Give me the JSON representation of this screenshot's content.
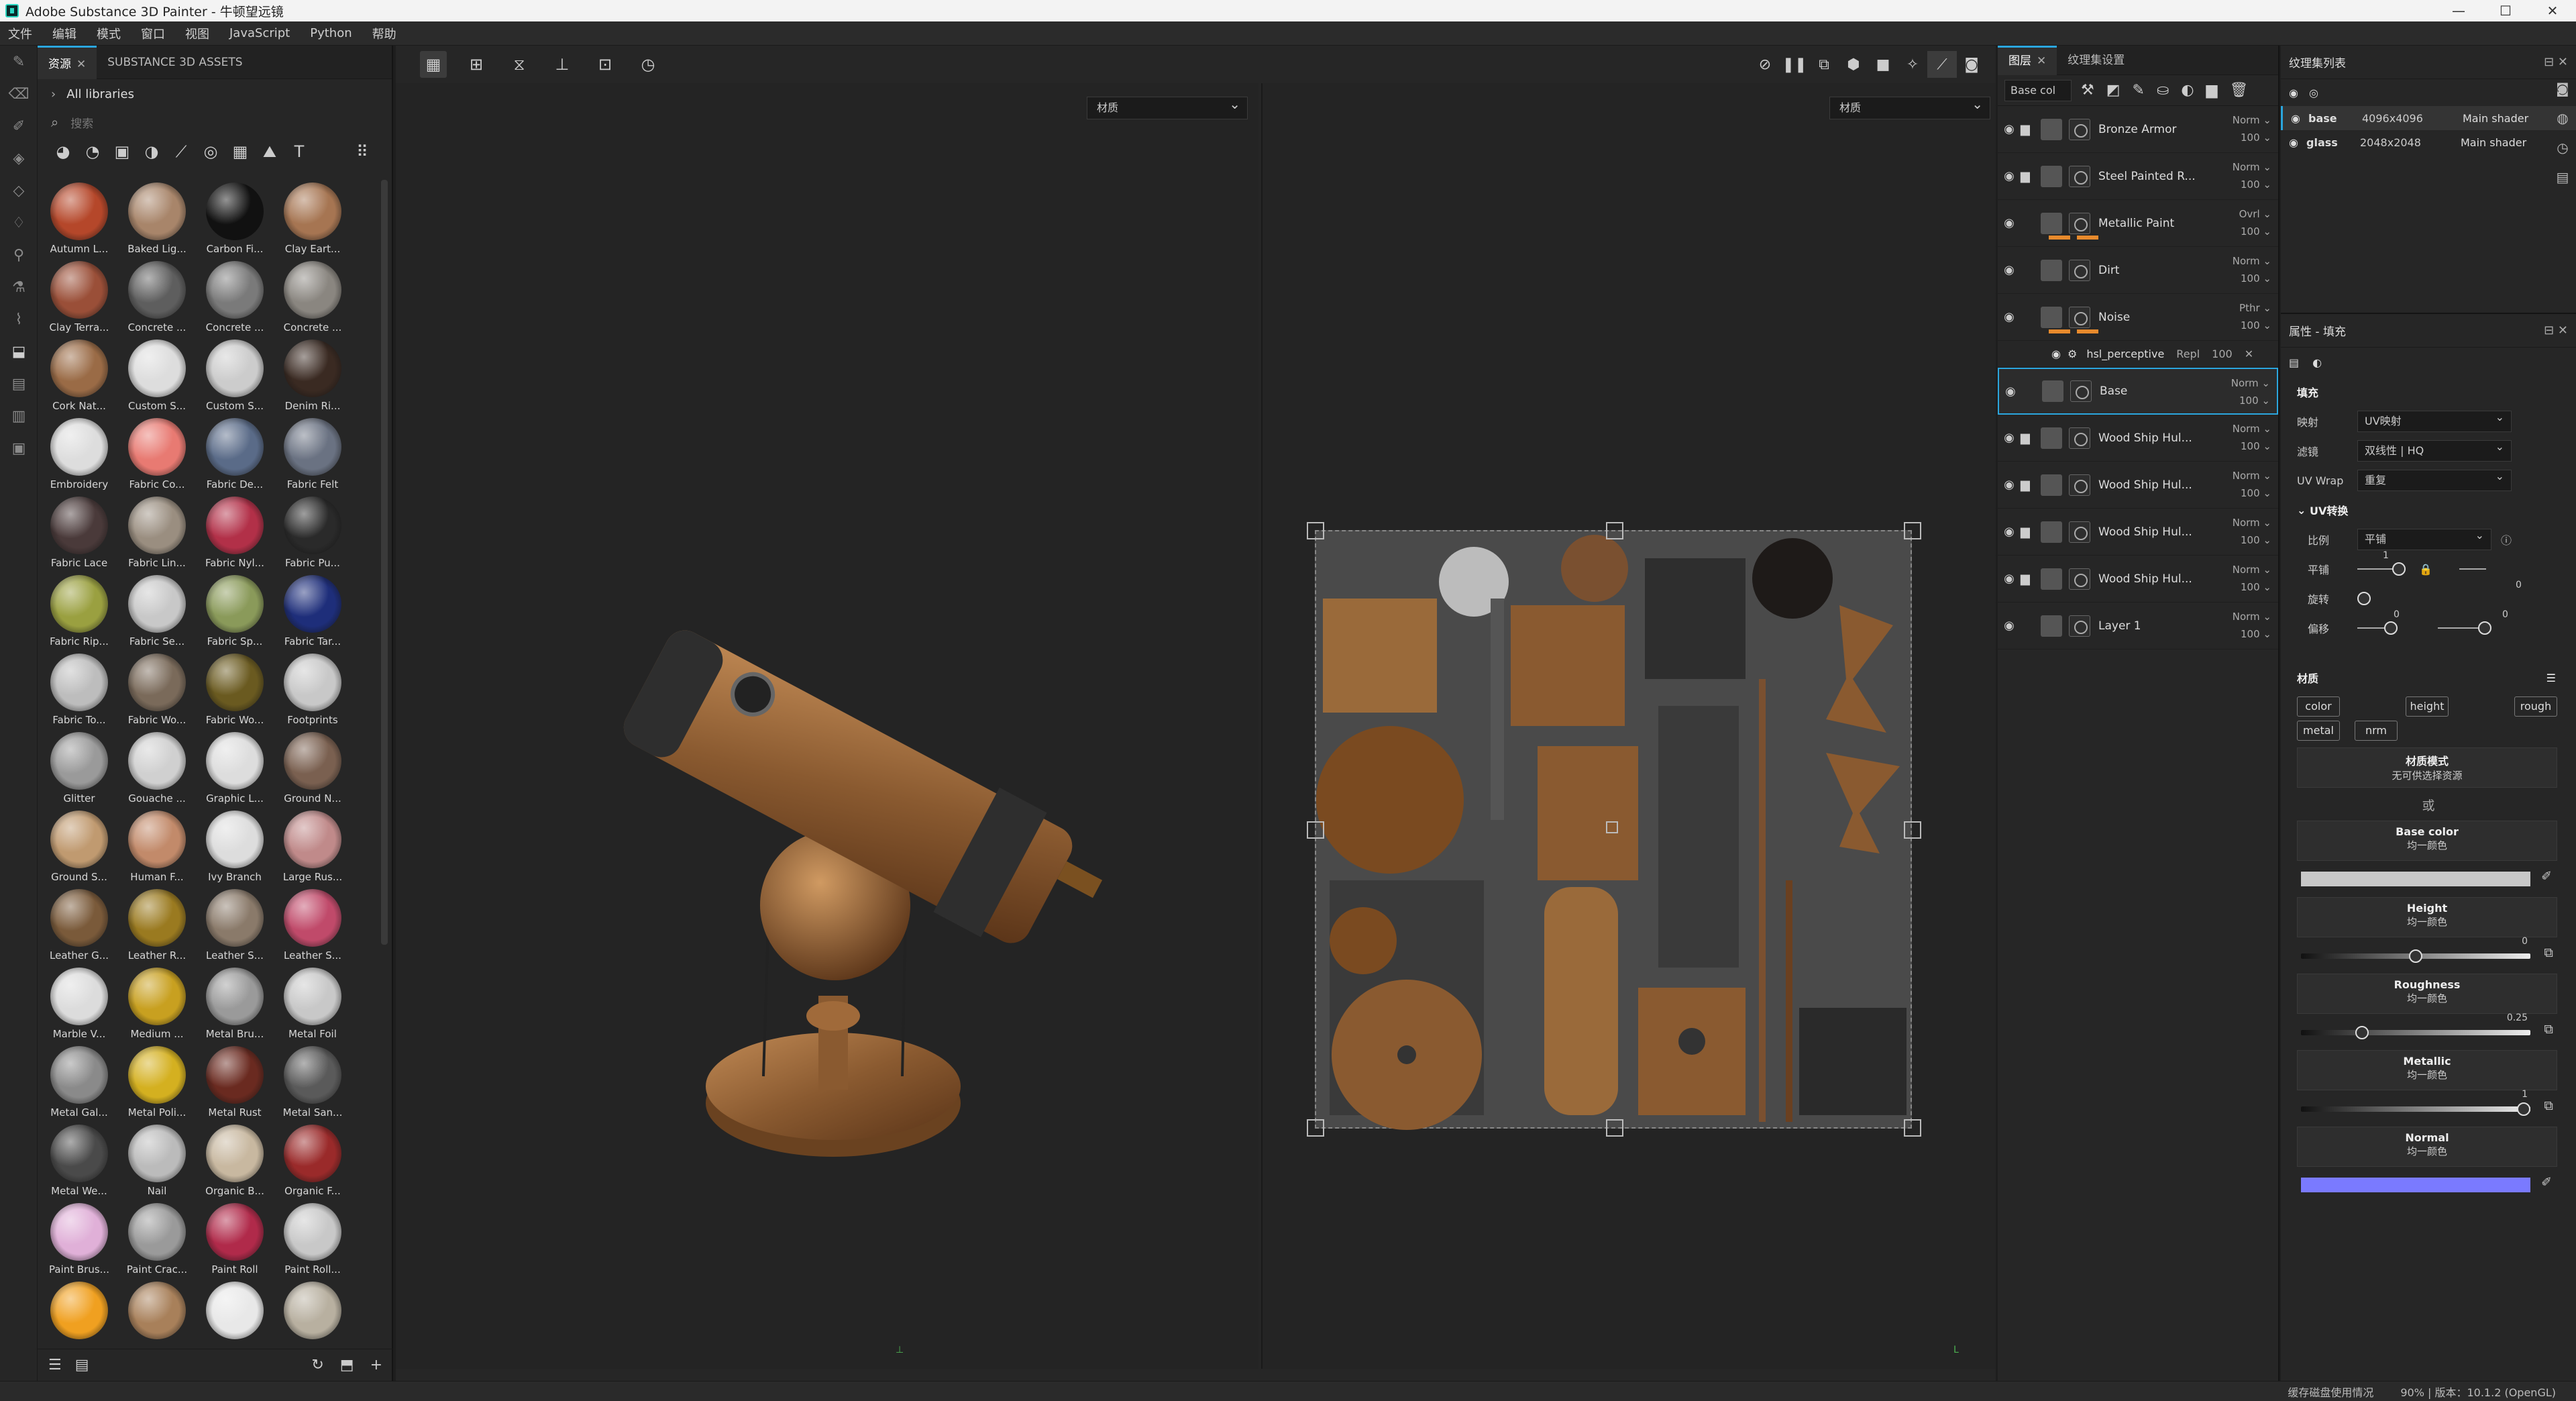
{
  "window": {
    "title": "Adobe Substance 3D Painter - 牛顿望远镜",
    "controls": [
      "—",
      "☐",
      "✕"
    ]
  },
  "menu": [
    "文件",
    "编辑",
    "模式",
    "窗口",
    "视图",
    "JavaScript",
    "Python",
    "帮助"
  ],
  "assets": {
    "tabs": [
      {
        "label": "资源"
      },
      {
        "label": "SUBSTANCE 3D ASSETS"
      }
    ],
    "breadcrumb": "All libraries",
    "search_placeholder": "搜索",
    "items": [
      {
        "name": "Autumn L...",
        "color": "#b5472a"
      },
      {
        "name": "Baked Lig...",
        "color": "#a8856a"
      },
      {
        "name": "Carbon Fi...",
        "color": "#111111"
      },
      {
        "name": "Clay Eart...",
        "color": "#a67552"
      },
      {
        "name": "Clay Terra...",
        "color": "#9a4f38"
      },
      {
        "name": "Concrete ...",
        "color": "#5e5e5e"
      },
      {
        "name": "Concrete ...",
        "color": "#7a7a7a"
      },
      {
        "name": "Concrete ...",
        "color": "#8a8680"
      },
      {
        "name": "Cork Nat...",
        "color": "#9a6b46"
      },
      {
        "name": "Custom S...",
        "color": "#dddddd"
      },
      {
        "name": "Custom S...",
        "color": "#cccccc"
      },
      {
        "name": "Denim Ri...",
        "color": "#3a2a22"
      },
      {
        "name": "Embroidery",
        "color": "#dddddd"
      },
      {
        "name": "Fabric Co...",
        "color": "#e87a72"
      },
      {
        "name": "Fabric De...",
        "color": "#5a6b88"
      },
      {
        "name": "Fabric Felt",
        "color": "#6a7282"
      },
      {
        "name": "Fabric Lace",
        "color": "#4a3a3a"
      },
      {
        "name": "Fabric Lin...",
        "color": "#9a8e80"
      },
      {
        "name": "Fabric Nyl...",
        "color": "#b23048"
      },
      {
        "name": "Fabric Pu...",
        "color": "#2a2a2a"
      },
      {
        "name": "Fabric Rip...",
        "color": "#9aa040"
      },
      {
        "name": "Fabric Se...",
        "color": "#c8c8c8"
      },
      {
        "name": "Fabric Sp...",
        "color": "#8a9a5a"
      },
      {
        "name": "Fabric Tar...",
        "color": "#1e2e7a"
      },
      {
        "name": "Fabric To...",
        "color": "#bdbdbd"
      },
      {
        "name": "Fabric Wo...",
        "color": "#7a6a5a"
      },
      {
        "name": "Fabric Wo...",
        "color": "#6a5a20"
      },
      {
        "name": "Footprints",
        "color": "#c8c8c8"
      },
      {
        "name": "Glitter",
        "color": "#9a9a9a"
      },
      {
        "name": "Gouache ...",
        "color": "#d0d0d0"
      },
      {
        "name": "Graphic L...",
        "color": "#dddddd"
      },
      {
        "name": "Ground N...",
        "color": "#7a6050"
      },
      {
        "name": "Ground S...",
        "color": "#c09a70"
      },
      {
        "name": "Human F...",
        "color": "#c28a6a"
      },
      {
        "name": "Ivy Branch",
        "color": "#dddddd"
      },
      {
        "name": "Large Rus...",
        "color": "#c08a8a"
      },
      {
        "name": "Leather G...",
        "color": "#7a5a3a"
      },
      {
        "name": "Leather R...",
        "color": "#9a7a20"
      },
      {
        "name": "Leather S...",
        "color": "#8a7a6a"
      },
      {
        "name": "Leather S...",
        "color": "#c04a6a"
      },
      {
        "name": "Marble V...",
        "color": "#dcdcdc"
      },
      {
        "name": "Medium ...",
        "color": "#c8a020"
      },
      {
        "name": "Metal Bru...",
        "color": "#9a9a9a"
      },
      {
        "name": "Metal Foil",
        "color": "#c8c8c8"
      },
      {
        "name": "Metal Gal...",
        "color": "#8a8a8a"
      },
      {
        "name": "Metal Poli...",
        "color": "#d4b020"
      },
      {
        "name": "Metal Rust",
        "color": "#6a2a20"
      },
      {
        "name": "Metal San...",
        "color": "#5a5a5a"
      },
      {
        "name": "Metal We...",
        "color": "#4a4a4a"
      },
      {
        "name": "Nail",
        "color": "#bbbbbb"
      },
      {
        "name": "Organic B...",
        "color": "#c8b8a0"
      },
      {
        "name": "Organic F...",
        "color": "#9a2a2a"
      },
      {
        "name": "Paint Brus...",
        "color": "#e0b0d8"
      },
      {
        "name": "Paint Crac...",
        "color": "#9a9a9a"
      },
      {
        "name": "Paint Roll",
        "color": "#b02a4a"
      },
      {
        "name": "Paint Roll...",
        "color": "#c8c8c8"
      },
      {
        "name": "",
        "color": "#f0a020"
      },
      {
        "name": "",
        "color": "#a8805a"
      },
      {
        "name": "",
        "color": "#e8e8e8"
      },
      {
        "name": "",
        "color": "#b8b0a0"
      }
    ]
  },
  "viewport": {
    "left_select": "材质",
    "right_select": "材质",
    "accent": "#2ba6de"
  },
  "layers": {
    "tabs": [
      "图层",
      "纹理集设置"
    ],
    "channel_select": "Base col",
    "items": [
      {
        "name": "Bronze Armor",
        "blend": "Norm",
        "opacity": "100",
        "group": true,
        "orange": false
      },
      {
        "name": "Steel Painted R...",
        "blend": "Norm",
        "opacity": "100",
        "group": true,
        "orange": false
      },
      {
        "name": "Metallic Paint",
        "blend": "Ovrl",
        "opacity": "100",
        "group": false,
        "orange": true
      },
      {
        "name": "Dirt",
        "blend": "Norm",
        "opacity": "100",
        "group": false,
        "orange": false
      },
      {
        "name": "Noise",
        "blend": "Pthr",
        "opacity": "100",
        "group": false,
        "orange": true
      },
      {
        "name": "Base",
        "blend": "Norm",
        "opacity": "100",
        "group": false,
        "orange": false,
        "selected": true
      },
      {
        "name": "Wood Ship Hul...",
        "blend": "Norm",
        "opacity": "100",
        "group": true,
        "orange": false
      },
      {
        "name": "Wood Ship Hul...",
        "blend": "Norm",
        "opacity": "100",
        "group": true,
        "orange": false
      },
      {
        "name": "Wood Ship Hul...",
        "blend": "Norm",
        "opacity": "100",
        "group": true,
        "orange": false
      },
      {
        "name": "Wood Ship Hul...",
        "blend": "Norm",
        "opacity": "100",
        "group": true,
        "orange": false
      },
      {
        "name": "Layer 1",
        "blend": "Norm",
        "opacity": "100",
        "group": false,
        "orange": false
      }
    ],
    "sub_effect": {
      "name": "hsl_perceptive",
      "blend": "Repl",
      "opacity": "100"
    }
  },
  "texture_sets": {
    "title": "纹理集列表",
    "rows": [
      {
        "name": "base",
        "size": "4096x4096",
        "shader": "Main shader",
        "selected": true
      },
      {
        "name": "glass",
        "size": "2048x2048",
        "shader": "Main shader"
      }
    ]
  },
  "properties": {
    "title": "属性 - 填充",
    "section_fill": "填充",
    "mapping_label": "映射",
    "mapping_value": "UV映射",
    "filter_label": "滤镜",
    "filter_value": "双线性 | HQ",
    "uvwrap_label": "UV Wrap",
    "uvwrap_value": "重复",
    "uv_transform": "UV转换",
    "scale_label": "比例",
    "scale_value": "平铺",
    "tile_label": "平铺",
    "tile_value": "1",
    "rotate_label": "旋转",
    "rotate_value": "0",
    "offset_label": "偏移",
    "offset_x": "0",
    "offset_y": "0",
    "material_label": "材质",
    "channels": [
      "color",
      "height",
      "rough",
      "metal",
      "nrm"
    ],
    "mode_title": "材质模式",
    "mode_sub": "无可供选择资源",
    "or": "或",
    "base_color": {
      "title": "Base color",
      "sub": "均一颜色",
      "swatch": "#c8c8c8"
    },
    "height": {
      "title": "Height",
      "sub": "均一颜色",
      "value": "0",
      "fraction": 0.5
    },
    "roughness": {
      "title": "Roughness",
      "sub": "均一颜色",
      "value": "0.25",
      "fraction": 0.25
    },
    "metallic": {
      "title": "Metallic",
      "sub": "均一颜色",
      "value": "1",
      "fraction": 1.0
    },
    "normal": {
      "title": "Normal",
      "sub": "均一颜色",
      "swatch": "#7a7aff"
    }
  },
  "status": {
    "disk": "缓存磁盘使用情况",
    "version": "90% | 版本：10.1.2 (OpenGL)"
  }
}
